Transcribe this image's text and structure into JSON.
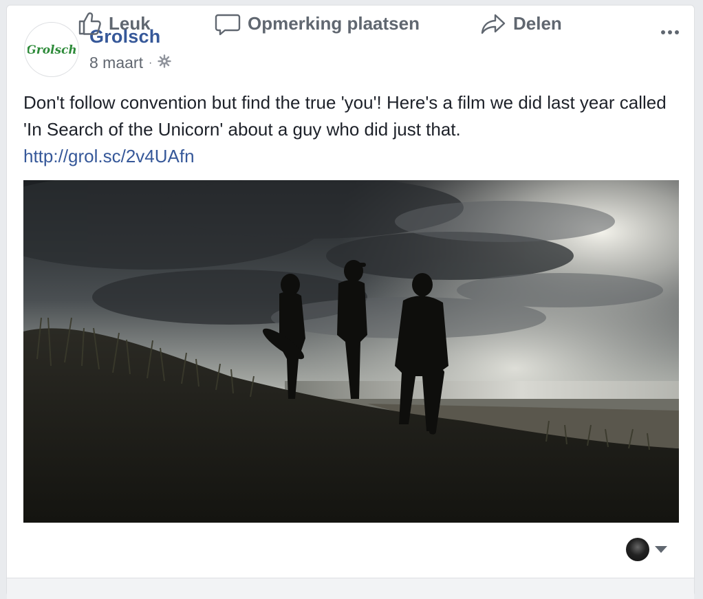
{
  "post": {
    "page_name": "Grolsch",
    "logo_text": "Grolsch",
    "date": "8 maart",
    "separator": "·",
    "privacy_icon": "globe-icon",
    "more_icon": "more-options-icon",
    "text": "Don't follow convention but find the true 'you'! Here's a film we did last year called 'In Search of the Unicorn' about a guy who did just that.",
    "link": "http://grol.sc/2v4UAfn",
    "media_icon": "video-thumbnail"
  },
  "actions": {
    "like_label": "Leuk",
    "comment_label": "Opmerking plaatsen",
    "share_label": "Delen"
  },
  "colors": {
    "brand_blue": "#365899",
    "logo_green": "#2e8b3a",
    "text": "#1d2129",
    "muted": "#606770"
  }
}
